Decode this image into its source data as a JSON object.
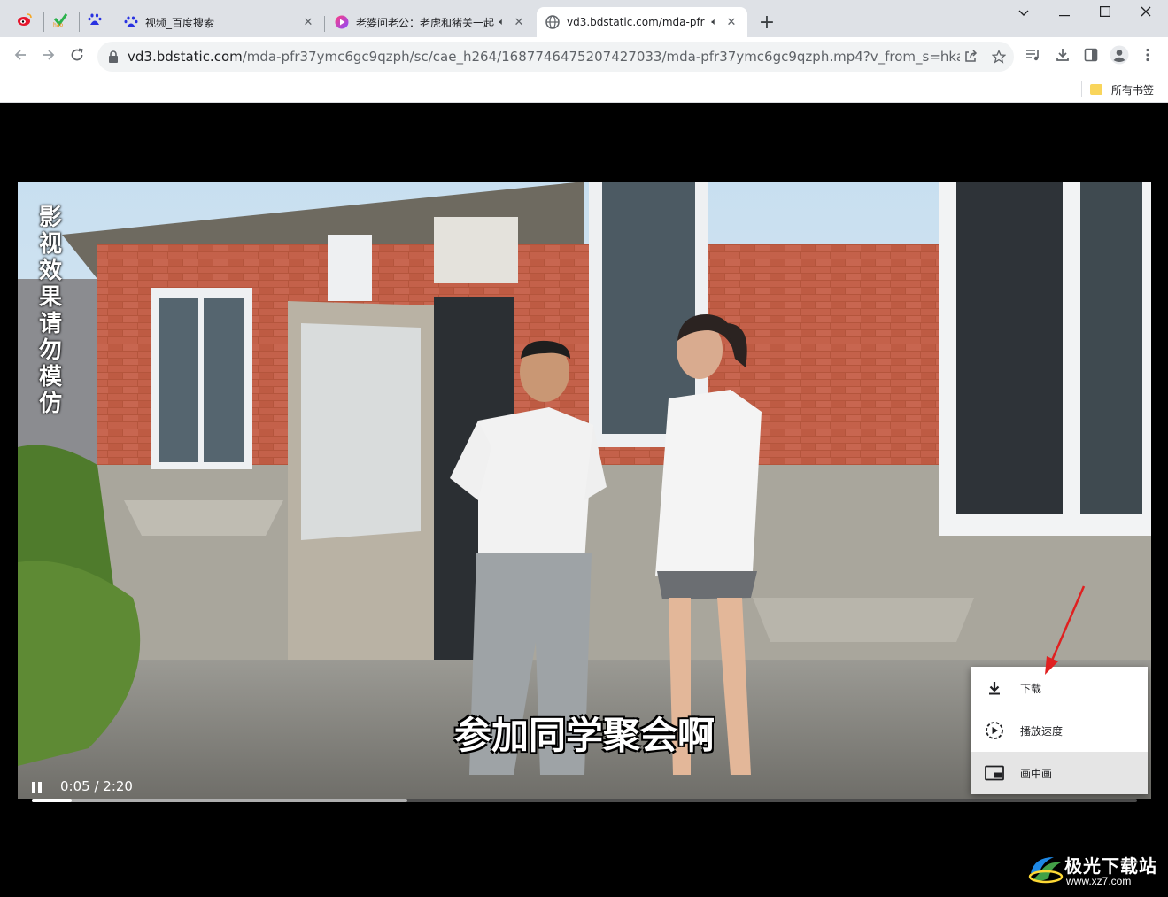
{
  "browser": {
    "tabs": [
      {
        "title": "视频_百度搜索",
        "active": false,
        "audio": false
      },
      {
        "title": "老婆问老公：老虎和猪关一起",
        "active": false,
        "audio": true
      },
      {
        "title": "vd3.bdstatic.com/mda-pfr",
        "active": true,
        "audio": true
      }
    ],
    "pinned_tabs": [
      "weibo-icon",
      "hao123-icon",
      "baidu-icon"
    ],
    "new_tab_label": "+",
    "window_controls": {
      "tabsearch": "⌵",
      "minimize": "—",
      "maximize": "☐",
      "close": "✕"
    }
  },
  "toolbar": {
    "url_host": "vd3.bdstatic.com",
    "url_path": "/mda-pfr37ymc6gc9qzph/sc/cae_h264/1687746475207427033/mda-pfr37ymc6gc9qzph.mp4?v_from_s=hkapp-haokan-..."
  },
  "bookmarks": {
    "all_bookmarks_label": "所有书签"
  },
  "video": {
    "vertical_watermark": "影视效果 请勿模仿",
    "subtitle": "参加同学聚会啊",
    "time_display": "0:05 / 2:20",
    "progress_fraction": 0.0357,
    "buffered_fraction": 0.34
  },
  "context_menu": {
    "items": [
      {
        "label": "下载",
        "icon": "download-icon"
      },
      {
        "label": "播放速度",
        "icon": "playback-speed-icon"
      },
      {
        "label": "画中画",
        "icon": "picture-in-picture-icon"
      }
    ],
    "hovered_index": 2
  },
  "site_watermark": {
    "name": "极光下载站",
    "url": "www.xz7.com"
  },
  "colors": {
    "tab_strip": "#dee1e6",
    "omnibox": "#f1f3f4",
    "annotation_arrow": "#e02020"
  }
}
